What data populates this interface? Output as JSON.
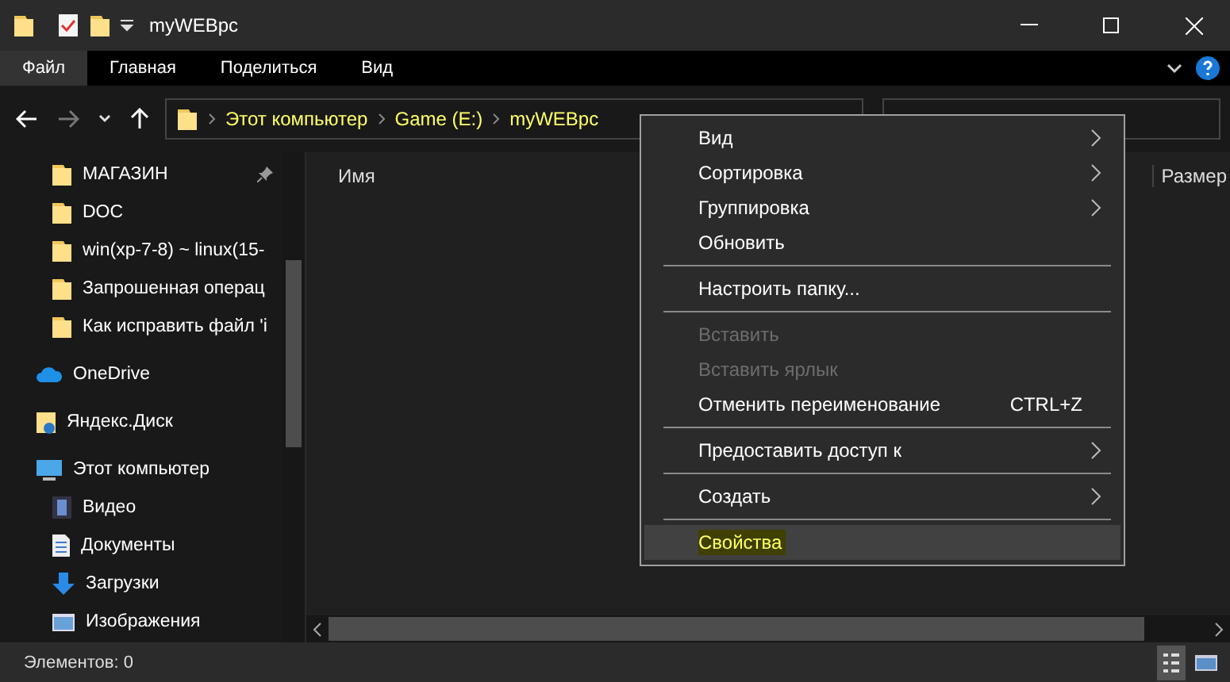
{
  "window": {
    "title": "myWEBpc"
  },
  "ribbon_tabs": [
    {
      "label": "Файл",
      "selected": true
    },
    {
      "label": "Главная",
      "selected": false
    },
    {
      "label": "Поделиться",
      "selected": false
    },
    {
      "label": "Вид",
      "selected": false
    }
  ],
  "breadcrumb": [
    "Этот компьютер",
    "Game (E:)",
    "myWEBpc"
  ],
  "sidebar": {
    "items": [
      {
        "label": "МАГАЗИН",
        "kind": "folder",
        "pinned": true
      },
      {
        "label": "DOC",
        "kind": "folder",
        "pinned": false
      },
      {
        "label": "win(xp-7-8) ~ linux(15-",
        "kind": "folder",
        "pinned": false
      },
      {
        "label": "Запрошенная операц",
        "kind": "folder",
        "pinned": false
      },
      {
        "label": "Как исправить файл 'i",
        "kind": "folder",
        "pinned": false
      },
      {
        "label": "OneDrive",
        "kind": "cloud",
        "pinned": false
      },
      {
        "label": "Яндекс.Диск",
        "kind": "disk",
        "pinned": false
      },
      {
        "label": "Этот компьютер",
        "kind": "computer",
        "pinned": false,
        "children": [
          {
            "label": "Видео",
            "kind": "video",
            "pinned": false
          },
          {
            "label": "Документы",
            "kind": "document",
            "pinned": false
          },
          {
            "label": "Загрузки",
            "kind": "download",
            "pinned": false
          },
          {
            "label": "Изображения",
            "kind": "image",
            "pinned": false
          }
        ]
      }
    ]
  },
  "columns": [
    "Имя",
    "Размер"
  ],
  "context_menu": [
    {
      "kind": "item",
      "label": "Вид",
      "submenu": true,
      "disabled": false,
      "selected": false
    },
    {
      "kind": "item",
      "label": "Сортировка",
      "submenu": true,
      "disabled": false,
      "selected": false
    },
    {
      "kind": "item",
      "label": "Группировка",
      "submenu": true,
      "disabled": false,
      "selected": false
    },
    {
      "kind": "item",
      "label": "Обновить",
      "submenu": false,
      "disabled": false,
      "selected": false
    },
    {
      "kind": "separator"
    },
    {
      "kind": "item",
      "label": "Настроить папку...",
      "submenu": false,
      "disabled": false,
      "selected": false
    },
    {
      "kind": "separator"
    },
    {
      "kind": "item",
      "label": "Вставить",
      "submenu": false,
      "disabled": true,
      "selected": false
    },
    {
      "kind": "item",
      "label": "Вставить ярлык",
      "submenu": false,
      "disabled": true,
      "selected": false
    },
    {
      "kind": "item",
      "label": "Отменить переименование",
      "shortcut": "CTRL+Z",
      "submenu": false,
      "disabled": false,
      "selected": false
    },
    {
      "kind": "separator"
    },
    {
      "kind": "item",
      "label": "Предоставить доступ к",
      "submenu": true,
      "disabled": false,
      "selected": false
    },
    {
      "kind": "separator"
    },
    {
      "kind": "item",
      "label": "Создать",
      "submenu": true,
      "disabled": false,
      "selected": false
    },
    {
      "kind": "separator"
    },
    {
      "kind": "item",
      "label": "Свойства",
      "submenu": false,
      "disabled": false,
      "selected": true
    }
  ],
  "status_bar": {
    "text": "Элементов: 0"
  }
}
